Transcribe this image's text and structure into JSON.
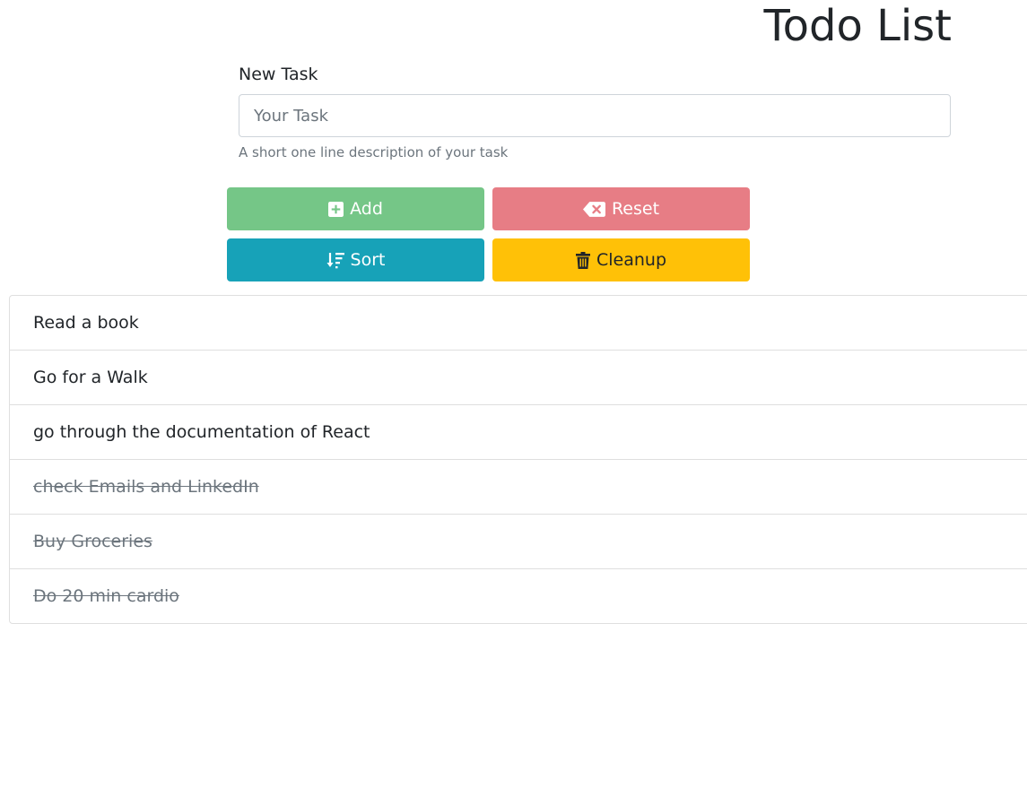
{
  "header": {
    "title": "Todo List"
  },
  "form": {
    "label": "New Task",
    "placeholder": "Your Task",
    "value": "",
    "help_text": "A short one line description of your task"
  },
  "buttons": {
    "add": {
      "label": "Add",
      "icon": "plus-square-icon",
      "color": "#75c687"
    },
    "reset": {
      "label": "Reset",
      "icon": "backspace-icon",
      "color": "#e77d85"
    },
    "sort": {
      "label": "Sort",
      "icon": "sort-down-icon",
      "color": "#17a2b8"
    },
    "cleanup": {
      "label": "Cleanup",
      "icon": "trash-icon",
      "color": "#ffc107"
    }
  },
  "tasks": [
    {
      "text": "Read a book",
      "done": false
    },
    {
      "text": "Go for a Walk",
      "done": false
    },
    {
      "text": "go through the documentation of React",
      "done": false
    },
    {
      "text": "check Emails and LinkedIn",
      "done": true
    },
    {
      "text": "Buy Groceries",
      "done": true
    },
    {
      "text": "Do 20 min cardio",
      "done": true
    }
  ]
}
